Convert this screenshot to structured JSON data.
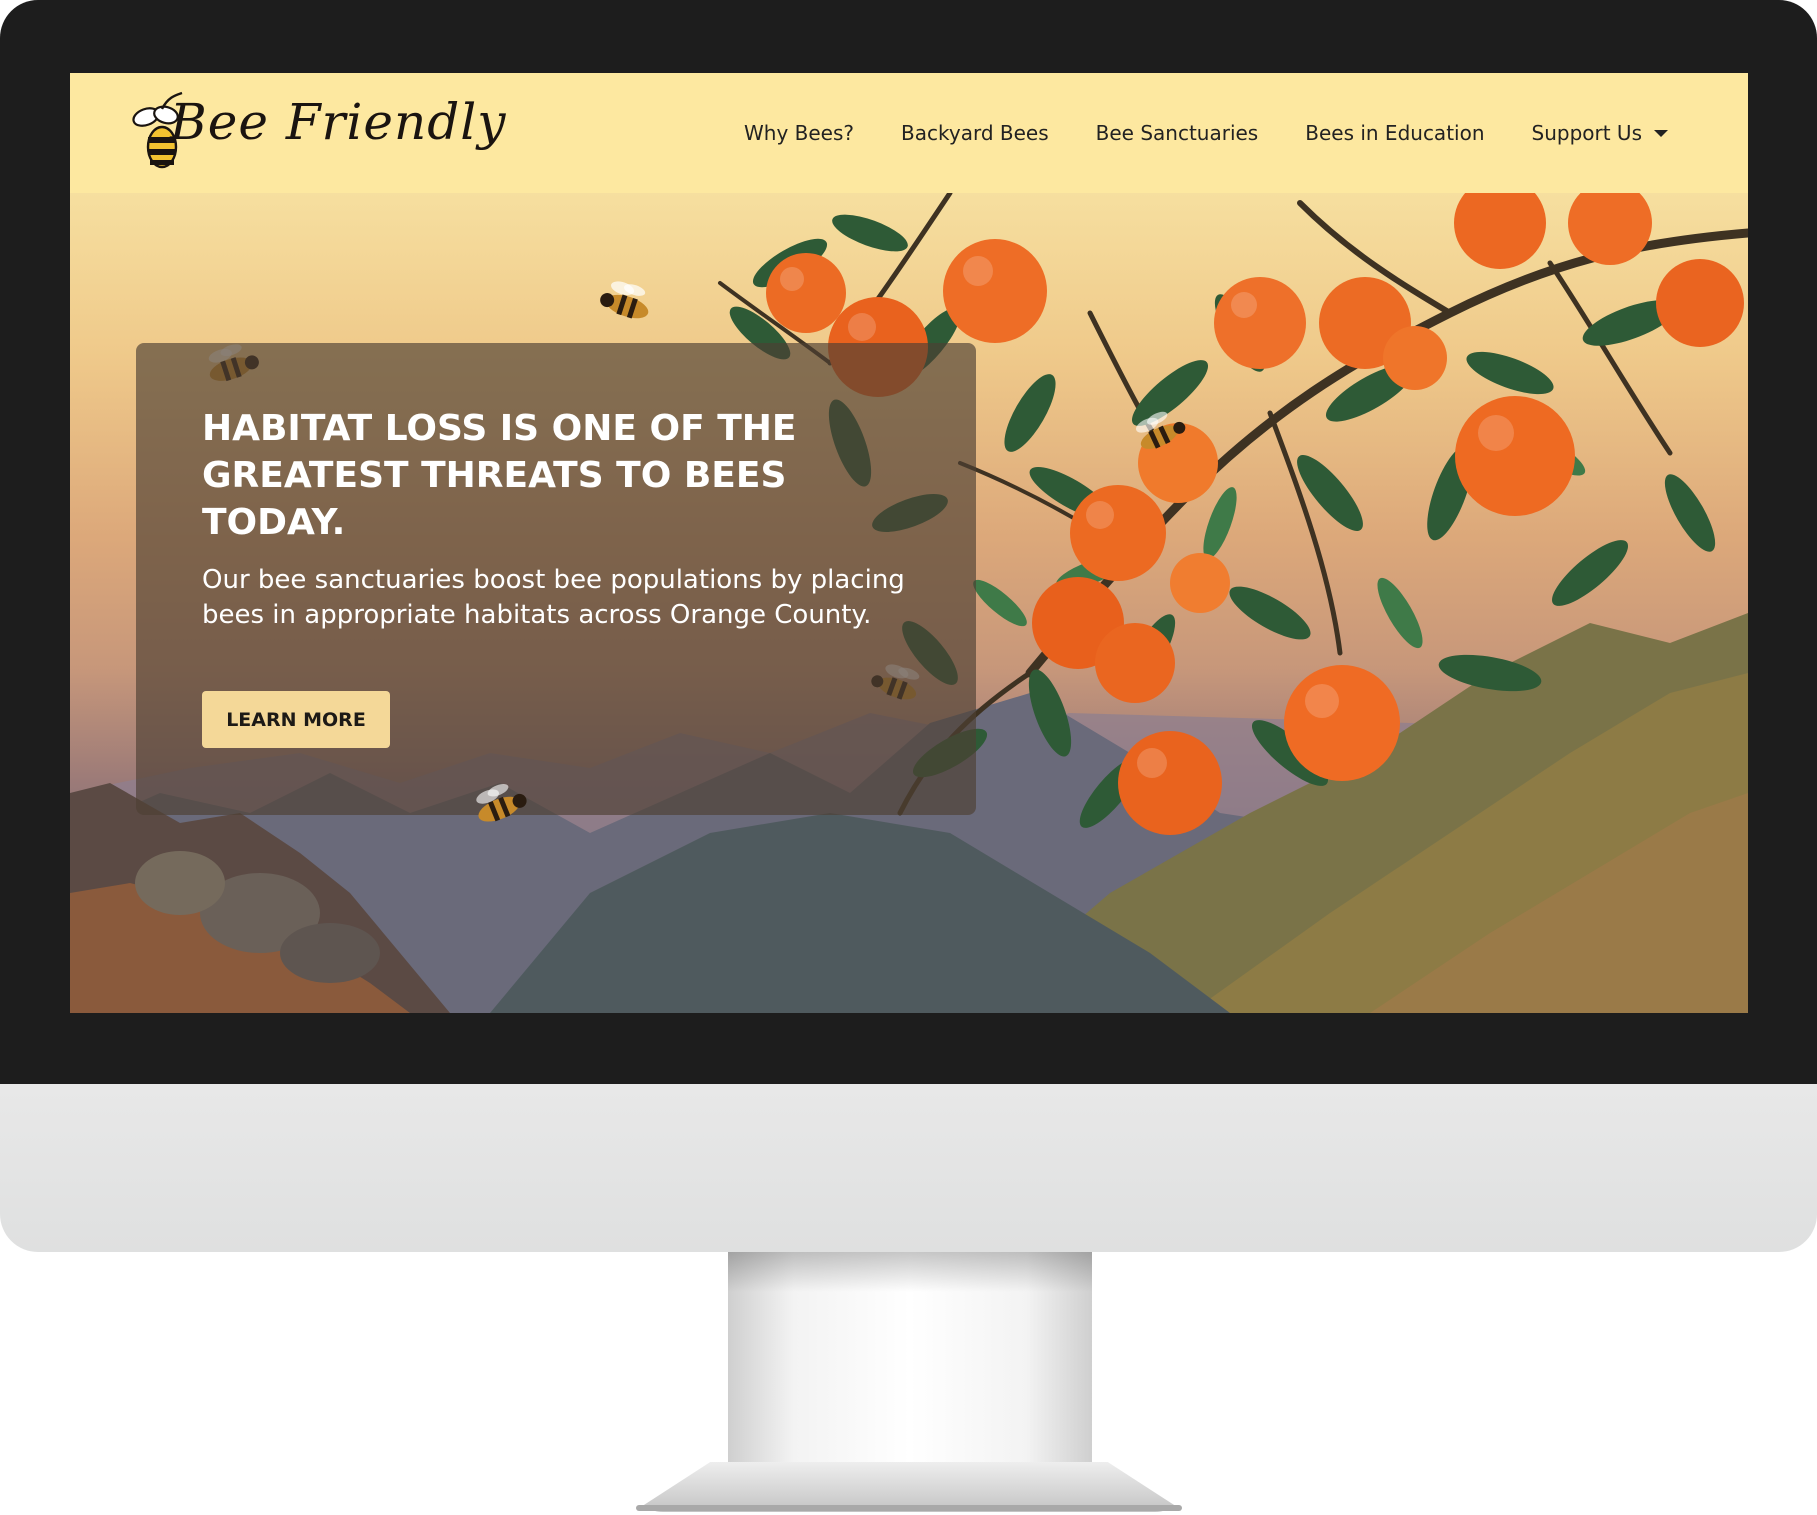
{
  "brand": {
    "name": "Bee Friendly",
    "logo_icon": "bee-icon"
  },
  "nav": {
    "items": [
      {
        "label": "Why Bees?"
      },
      {
        "label": "Backyard Bees"
      },
      {
        "label": "Bee Sanctuaries"
      },
      {
        "label": "Bees in Education"
      },
      {
        "label": "Support Us",
        "dropdown_icon": "caret-down-icon"
      }
    ]
  },
  "hero": {
    "headline": "Habitat loss is one of the greatest threats to bees today.",
    "description": "Our bee sanctuaries boost bee populations by placing bees in appropriate habitats across Orange County.",
    "cta_label": "LEARN MORE",
    "background_image": "orange-tree-with-bees-and-mountains"
  },
  "colors": {
    "navbar_bg": "#fde8a0",
    "button_bg": "#f4d898",
    "bezel": "#1d1d1d",
    "chin": "#e4e5e5"
  }
}
